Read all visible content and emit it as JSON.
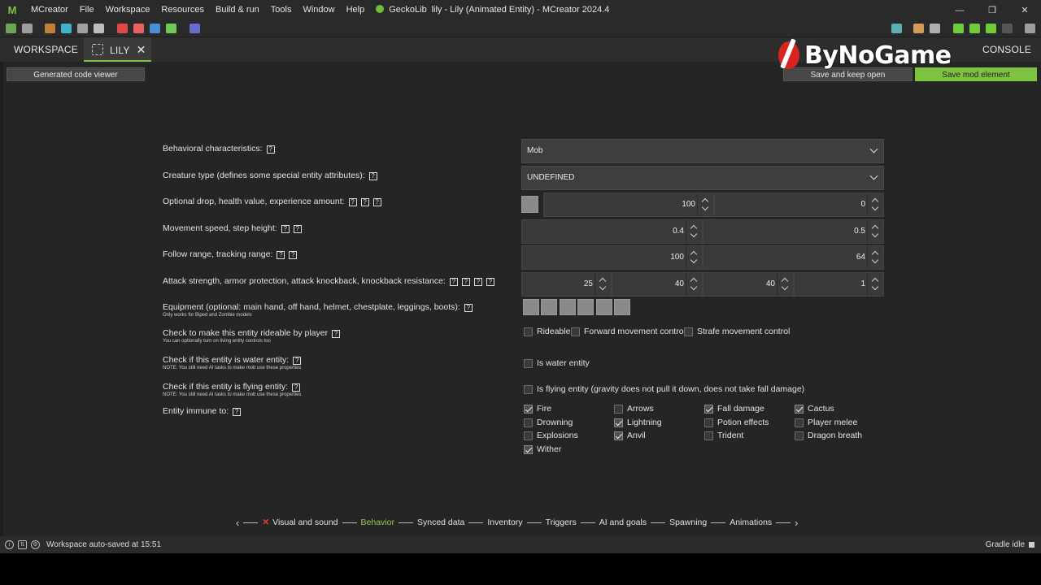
{
  "titlebar": {
    "menu": [
      "MCreator",
      "File",
      "Workspace",
      "Resources",
      "Build & run",
      "Tools",
      "Window",
      "Help",
      "GeckoLib"
    ],
    "title": "lily - Lily (Animated Entity) - MCreator 2024.4"
  },
  "tabs": {
    "workspace": "WORKSPACE",
    "current": "LILY",
    "console": "CONSOLE"
  },
  "actions": {
    "code_viewer": "Generated code viewer",
    "save_keep_open": "Save and keep open",
    "save_element": "Save mod element"
  },
  "watermark": "ByNoGame",
  "fields": {
    "behavioral": "Behavioral characteristics:",
    "creature_type": "Creature type (defines some special entity attributes):",
    "drop_health_xp": "Optional drop, health value, experience amount:",
    "movement": "Movement speed, step height:",
    "follow": "Follow range, tracking range:",
    "attack": "Attack strength, armor protection, attack knockback, knockback resistance:",
    "equipment": "Equipment (optional: main hand, off hand, helmet, chestplate, leggings, boots):",
    "equipment_note": "Only works for Biped and Zombie models",
    "rideable": "Check to make this entity rideable by player",
    "rideable_note": "You can optionally turn on living entity controls too",
    "water": "Check if this entity is water entity:",
    "water_note": "NOTE: You still need AI tasks to make mob use these properties",
    "flying": "Check if this entity is flying entity:",
    "flying_note": "NOTE: You still need AI tasks to make mob use these properties",
    "immune": "Entity immune to:"
  },
  "values": {
    "behavioral": "Mob",
    "creature_type": "UNDEFINED",
    "health": "100",
    "xp": "0",
    "speed": "0.4",
    "step": "0.5",
    "follow_range": "100",
    "tracking_range": "64",
    "attack_strength": "25",
    "armor": "40",
    "knockback": "40",
    "kb_resistance": "1"
  },
  "checks": {
    "rideable": "Rideable",
    "forward": "Forward movement control",
    "strafe": "Strafe movement control",
    "water": "Is water entity",
    "flying": "Is flying entity (gravity does not pull it down, does not take fall damage)"
  },
  "immunities": [
    {
      "label": "Fire",
      "checked": true
    },
    {
      "label": "Arrows",
      "checked": false
    },
    {
      "label": "Fall damage",
      "checked": true
    },
    {
      "label": "Cactus",
      "checked": true
    },
    {
      "label": "Drowning",
      "checked": false
    },
    {
      "label": "Lightning",
      "checked": true
    },
    {
      "label": "Potion effects",
      "checked": false
    },
    {
      "label": "Player melee",
      "checked": false
    },
    {
      "label": "Explosions",
      "checked": false
    },
    {
      "label": "Anvil",
      "checked": true
    },
    {
      "label": "Trident",
      "checked": false
    },
    {
      "label": "Dragon breath",
      "checked": false
    },
    {
      "label": "Wither",
      "checked": true
    }
  ],
  "pages": [
    "Visual and sound",
    "Behavior",
    "Synced data",
    "Inventory",
    "Triggers",
    "AI and goals",
    "Spawning",
    "Animations"
  ],
  "status": {
    "text": "Workspace auto-saved at 15:51",
    "gradle": "Gradle idle"
  },
  "colors": {
    "accent": "#7ec242",
    "error": "#e04040"
  }
}
